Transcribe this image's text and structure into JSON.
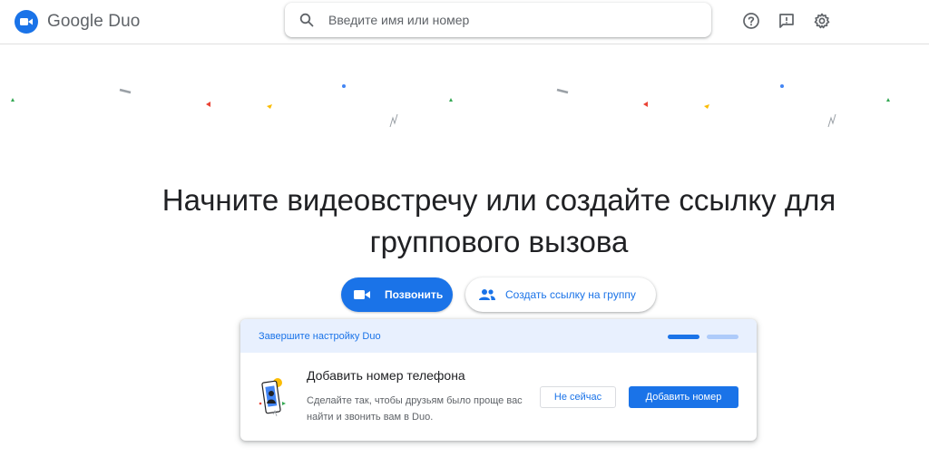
{
  "header": {
    "logo_text": "Google Duo",
    "search_placeholder": "Введите имя или номер",
    "icons": [
      "help-icon",
      "feedback-icon",
      "settings-icon"
    ]
  },
  "main": {
    "title_line1": "Начните видеовстречу или создайте ссылку для",
    "title_line2": "группового вызова",
    "call_button": "Позвонить",
    "group_link_button": "Создать ссылку на группу"
  },
  "setup_card": {
    "header": "Завершите настройку Duo",
    "progress": {
      "steps": 2,
      "completed": 1
    },
    "title": "Добавить номер телефона",
    "description": "Сделайте так, чтобы друзьям было проще вас найти и звонить вам в Duo.",
    "later_button": "Не сейчас",
    "add_button": "Добавить номер"
  },
  "colors": {
    "accent": "#1a73e8",
    "card_header_bg": "#e8f0fe",
    "progress_inactive": "#aecbfa"
  }
}
